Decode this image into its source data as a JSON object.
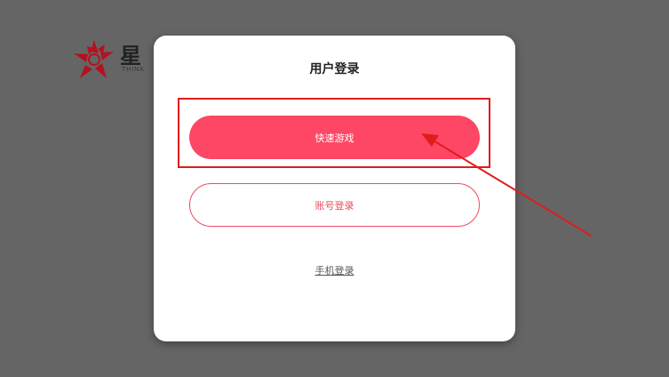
{
  "backdrop": {
    "logo_text": "星",
    "logo_sub": "THINK"
  },
  "modal": {
    "title": "用户登录",
    "quick_play_label": "快速游戏",
    "account_login_label": "账号登录",
    "phone_login_label": "手机登录"
  },
  "colors": {
    "primary": "#fd4765",
    "annotation": "#e01c1c",
    "overlay": "#666566"
  },
  "annotation": {
    "icon": "arrow-icon"
  }
}
